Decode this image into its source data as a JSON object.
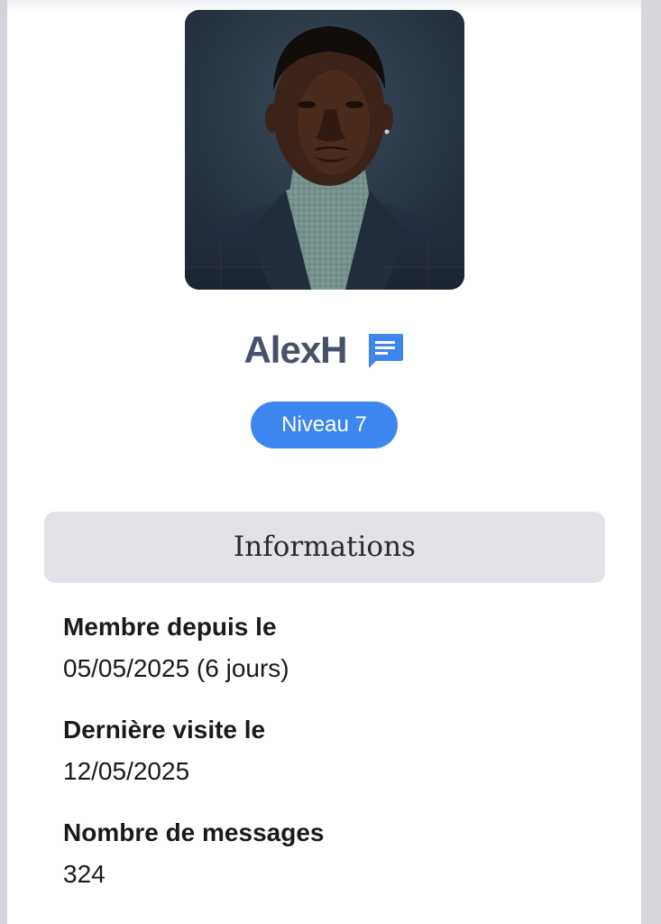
{
  "profile": {
    "username": "AlexH",
    "avatar_icon": "profile-photo",
    "message_icon": "chat-message-icon",
    "level_label": "Niveau 7"
  },
  "info": {
    "header": "Informations",
    "items": [
      {
        "label": "Membre depuis le",
        "value": "05/05/2025 (6 jours)"
      },
      {
        "label": "Dernière visite le",
        "value": "12/05/2025"
      },
      {
        "label": "Nombre de messages",
        "value": "324"
      }
    ]
  },
  "colors": {
    "accent": "#3d86f0",
    "username": "#475268",
    "header_bg": "#e2e3e8"
  }
}
